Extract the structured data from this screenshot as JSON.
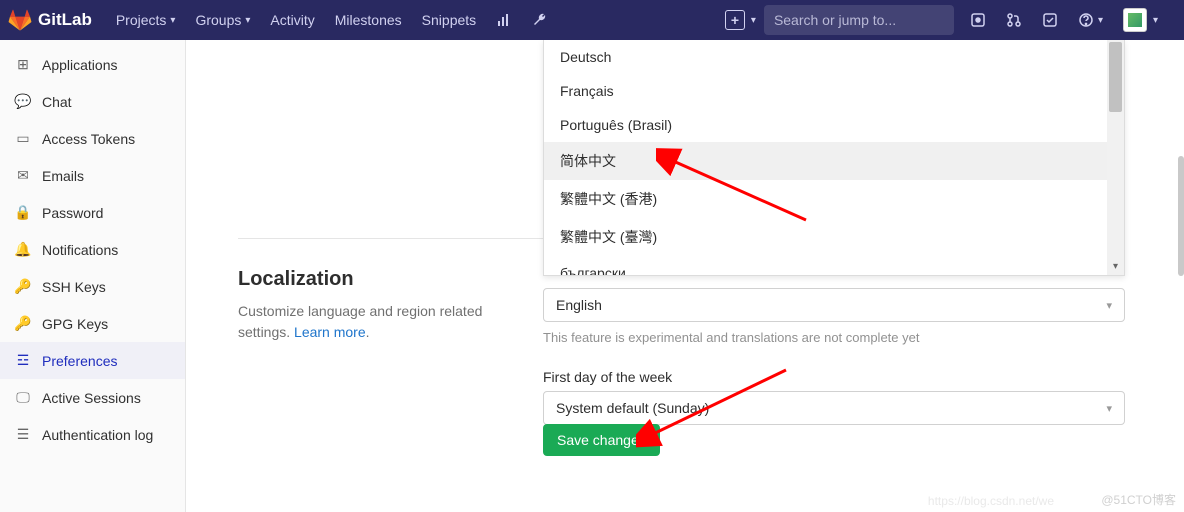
{
  "brand": "GitLab",
  "nav": {
    "projects": "Projects",
    "groups": "Groups",
    "activity": "Activity",
    "milestones": "Milestones",
    "snippets": "Snippets"
  },
  "search": {
    "placeholder": "Search or jump to..."
  },
  "sidebar": {
    "items": [
      {
        "label": "Applications"
      },
      {
        "label": "Chat"
      },
      {
        "label": "Access Tokens"
      },
      {
        "label": "Emails"
      },
      {
        "label": "Password"
      },
      {
        "label": "Notifications"
      },
      {
        "label": "SSH Keys"
      },
      {
        "label": "GPG Keys"
      },
      {
        "label": "Preferences"
      },
      {
        "label": "Active Sessions"
      },
      {
        "label": "Authentication log"
      }
    ]
  },
  "localization": {
    "title": "Localization",
    "desc": "Customize language and region related settings.",
    "learn_more": "Learn more",
    "language_selected": "English",
    "language_hint": "This feature is experimental and translations are not complete yet",
    "first_day_label": "First day of the week",
    "first_day_value": "System default (Sunday)",
    "save": "Save changes"
  },
  "dropdown": {
    "items": [
      {
        "label": "Deutsch"
      },
      {
        "label": "Français"
      },
      {
        "label": "Português (Brasil)"
      },
      {
        "label": "简体中文",
        "highlight": true
      },
      {
        "label": "繁體中文 (香港)"
      },
      {
        "label": "繁體中文 (臺灣)"
      },
      {
        "label": "български"
      }
    ]
  },
  "watermark": "@51CTO博客",
  "watermark2": "https://blog.csdn.net/we"
}
